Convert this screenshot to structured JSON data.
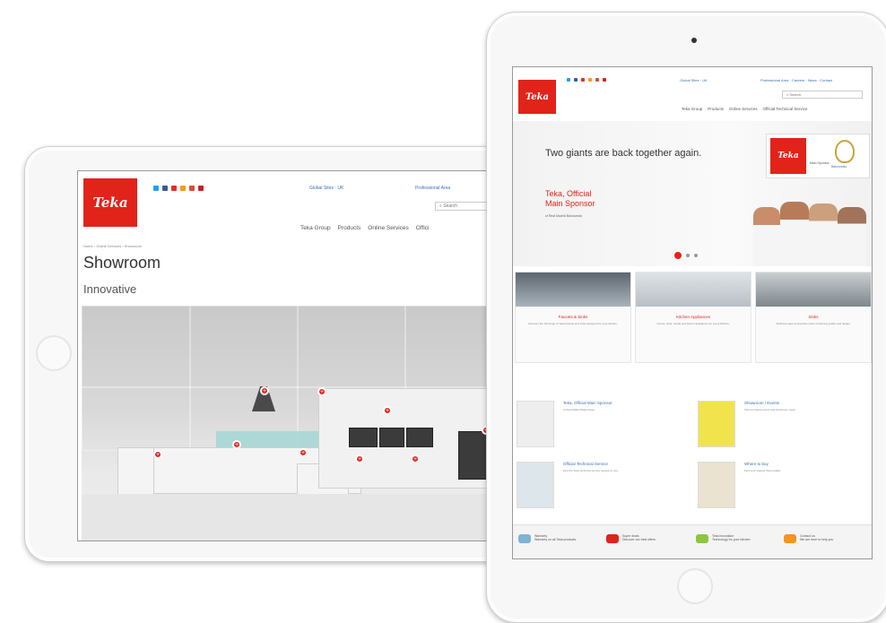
{
  "brand": {
    "logo_text": "Teka",
    "accent_color": "#e2231a",
    "link_color": "#3a6fb0"
  },
  "social_icons": [
    "twitter-icon",
    "facebook-icon",
    "youtube-icon",
    "rss-icon",
    "googleplus-icon",
    "pinterest-icon"
  ],
  "left_tablet": {
    "topbar": {
      "region": "Global Sites · UK",
      "professional": "Professional Area",
      "search_placeholder": "Search"
    },
    "nav": [
      "Teka Group",
      "Products",
      "Online Services",
      "Offici"
    ],
    "breadcrumb": "Home › Online Services › Showroom",
    "title": "Showroom",
    "subtitle": "Innovative"
  },
  "right_tablet": {
    "topbar": {
      "region": "Global Sites · UK",
      "professional": "Professional Area · Careers · News · Contact",
      "search_placeholder": "Search"
    },
    "nav": [
      "Teka Group",
      "Products",
      "Online Services",
      "Official Technical Service"
    ],
    "hero": {
      "headline": "Two giants are back together again.",
      "sponsor_line1": "Teka, Official",
      "sponsor_line2": "Main Sponsor",
      "sponsor_small": "of Real Madrid Baloncesto",
      "box_logo": "Teka",
      "box_caption": "Main Sponsor",
      "crest_caption": "Baloncesto"
    },
    "cards": [
      {
        "title": "Faucets & Sinks",
        "text": "Discover the full range of Teka faucets and sinks designed for your kitchen."
      },
      {
        "title": "Kitchen Appliances",
        "text": "Ovens, hobs, hoods and built-in appliances for every kitchen."
      },
      {
        "title": "Sinks",
        "text": "Stainless steel and granite sinks combining quality and design."
      }
    ],
    "news": [
      {
        "title": "Teka, Official Main Sponsor",
        "text": "of Real Madrid Baloncesto"
      },
      {
        "title": "Showroom / Events",
        "text": "Visit our latest events and showroom news."
      },
      {
        "title": "Official Technical Service",
        "text": "Find the Teka technical service nearest to you."
      },
      {
        "title": "Where to buy",
        "text": "Find your nearest Teka retailer."
      }
    ],
    "features": [
      {
        "title": "Warranty",
        "text": "Warranty on all Teka products",
        "icon": "eye-icon"
      },
      {
        "title": "Super deals",
        "text": "Discover our best offers",
        "icon": "list-icon"
      },
      {
        "title": "Teka innovation",
        "text": "Technology for your kitchen",
        "icon": "recycle-icon"
      },
      {
        "title": "Contact us",
        "text": "We are here to help you",
        "icon": "user-icon"
      }
    ]
  }
}
